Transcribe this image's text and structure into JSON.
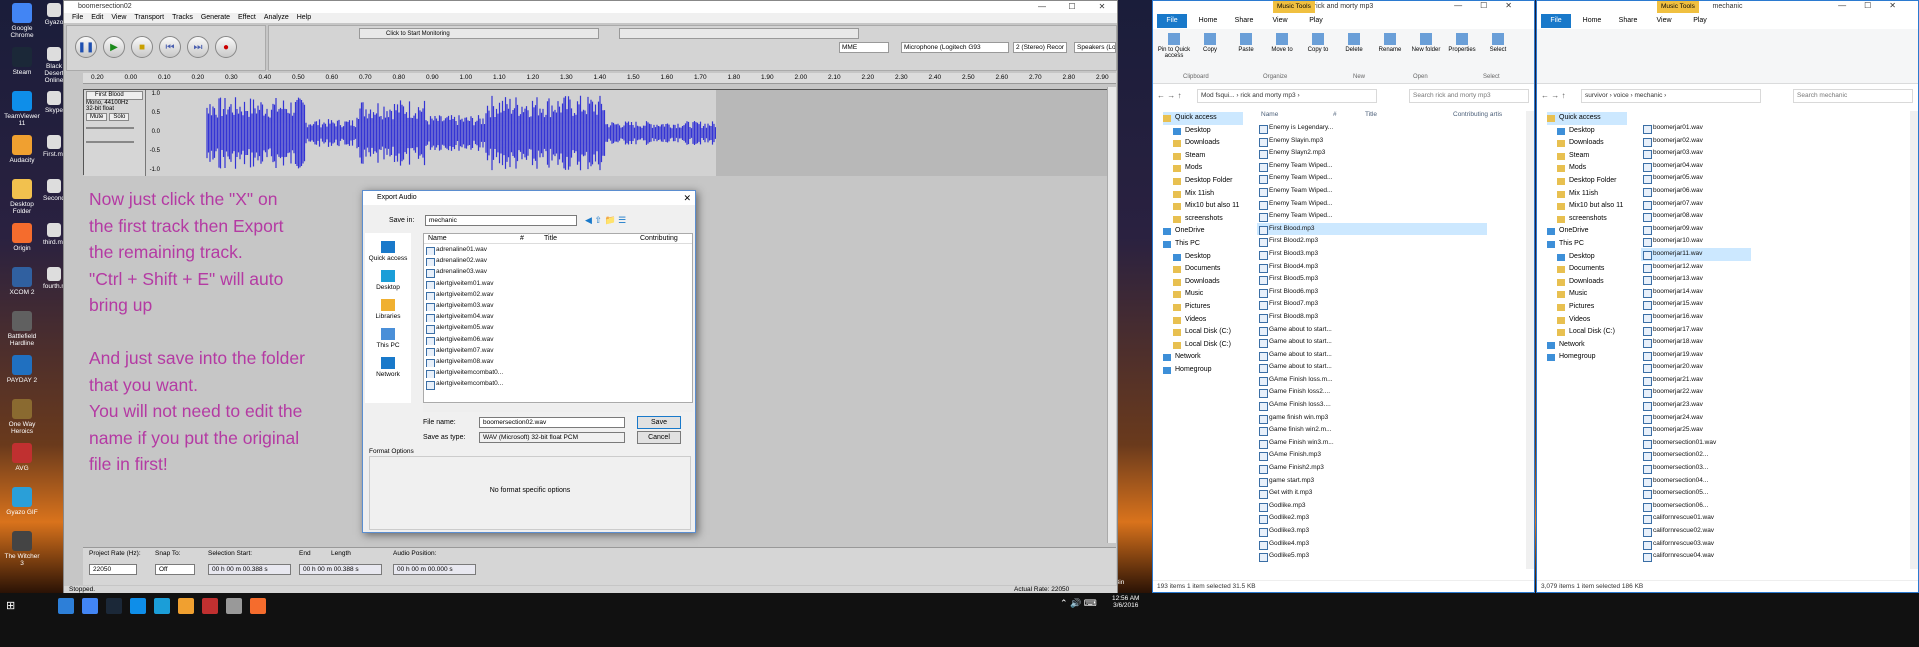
{
  "desktop": {
    "icons": [
      "Google Chrome",
      "Steam",
      "TeamViewer 11",
      "Audacity",
      "Desktop Folder",
      "Origin",
      "XCOM 2",
      "Battlefield Hardline",
      "PAYDAY 2",
      "One Way Heroics",
      "AVG",
      "Gyazo GIF",
      "The Witcher 3"
    ],
    "icons2": [
      "Gyazo",
      "Black Desert Online",
      "Skype",
      "First.mp3",
      "Second.mp3",
      "third.mp3",
      "fourth.mp3"
    ],
    "recycle": "Recycle Bin"
  },
  "audacity": {
    "title": "boomersection02",
    "menu": [
      "File",
      "Edit",
      "View",
      "Transport",
      "Tracks",
      "Generate",
      "Effect",
      "Analyze",
      "Help"
    ],
    "meter_text": "Click to Start Monitoring",
    "meter_ticks": [
      "-57",
      "-54",
      "-51",
      "-48",
      "-45",
      "-42",
      "-3",
      "-18",
      "-15",
      "-12",
      "-9",
      "-6",
      "-3",
      "0"
    ],
    "meter_ticks2": [
      "-57",
      "-54",
      "-51",
      "-48",
      "-45",
      "-42",
      "-39",
      "-36",
      "-30",
      "-27",
      "-24",
      "-21",
      "-18",
      "-15",
      "-12",
      "-9",
      "-6",
      "-3",
      "0"
    ],
    "host": "MME",
    "mic": "Microphone (Logitech G93",
    "channels": "2 (Stereo) Recor",
    "speakers": "Speakers (Logitech G930 Ga",
    "ruler": [
      "0.20",
      "0.00",
      "0.10",
      "0.20",
      "0.30",
      "0.40",
      "0.50",
      "0.60",
      "0.70",
      "0.80",
      "0.90",
      "1.00",
      "1.10",
      "1.20",
      "1.30",
      "1.40",
      "1.50",
      "1.60",
      "1.70",
      "1.80",
      "1.90",
      "2.00",
      "2.10",
      "2.20",
      "2.30",
      "2.40",
      "2.50",
      "2.60",
      "2.70",
      "2.80",
      "2.90"
    ],
    "track": {
      "name": "First Blood",
      "info1": "Mono, 44100Hz",
      "info2": "32-bit float",
      "mute": "Mute",
      "solo": "Solo",
      "scale": [
        "1.0",
        "0.5",
        "0.0",
        "-0.5",
        "-1.0"
      ]
    },
    "instructions": [
      "Now just click the \"X\" on",
      "the first track then Export",
      "the remaining track.",
      "\"Ctrl + Shift + E\" will auto",
      "bring up",
      "",
      "And just save into the folder",
      "that you want.",
      "You will not need to edit the",
      "name if you put the original",
      "file in first!"
    ],
    "bottom": {
      "rate_label": "Project Rate (Hz):",
      "rate": "22050",
      "snap_label": "Snap To:",
      "snap": "Off",
      "sel_label": "Selection Start:",
      "sel": "00 h 00 m 00.388 s",
      "end": "End",
      "length": "Length",
      "end_val": "00 h 00 m 00.388 s",
      "pos_label": "Audio Position:",
      "pos": "00 h 00 m 00.000 s"
    },
    "status": "Stopped.",
    "actual_rate": "Actual Rate: 22050"
  },
  "dialog": {
    "title": "Export Audio",
    "save_in_label": "Save in:",
    "save_in": "mechanic",
    "places": [
      "Quick access",
      "Desktop",
      "Libraries",
      "This PC",
      "Network"
    ],
    "cols": [
      "Name",
      "#",
      "Title",
      "Contributing"
    ],
    "files": [
      "adrenaline01.wav",
      "adrenaline02.wav",
      "adrenaline03.wav",
      "alertgiveitem01.wav",
      "alertgiveitem02.wav",
      "alertgiveitem03.wav",
      "alertgiveitem04.wav",
      "alertgiveitem05.wav",
      "alertgiveitem06.wav",
      "alertgiveitem07.wav",
      "alertgiveitem08.wav",
      "alertgiveitemcombat0...",
      "alertgiveitemcombat0..."
    ],
    "filename_label": "File name:",
    "filename": "boomersection02.wav",
    "type_label": "Save as type:",
    "type": "WAV (Microsoft) 32-bit float PCM",
    "save": "Save",
    "cancel": "Cancel",
    "options_label": "Format Options",
    "no_options": "No format specific options"
  },
  "exp1": {
    "title": "rick and morty mp3",
    "tools": "Music Tools",
    "tabs": [
      "File",
      "Home",
      "Share",
      "View",
      "Play"
    ],
    "groups": [
      "Clipboard",
      "Organize",
      "New",
      "Open",
      "Select"
    ],
    "rib": [
      "Pin to Quick access",
      "Copy",
      "Paste",
      "Move to",
      "Copy to",
      "Delete",
      "Rename",
      "New folder",
      "Properties",
      "Select"
    ],
    "path": [
      "Mod fsqui...",
      "rick and morty mp3"
    ],
    "search": "Search rick and morty mp3",
    "cols": [
      "Name",
      "#",
      "Title",
      "Contributing artis"
    ],
    "nav": [
      "Quick access",
      "Desktop",
      "Downloads",
      "Steam",
      "Mods",
      "Desktop Folder",
      "Mix 11ish",
      "Mix10 but also 11",
      "screenshots",
      "OneDrive",
      "This PC",
      "Desktop",
      "Documents",
      "Downloads",
      "Music",
      "Pictures",
      "Videos",
      "Local Disk (C:)",
      "Local Disk (C:)",
      "Network",
      "Homegroup"
    ],
    "files": [
      "Enemy is Legendary...",
      "Enemy Slayin.mp3",
      "Enemy Slayn2.mp3",
      "Enemy Team Wiped...",
      "Enemy Team Wiped...",
      "Enemy Team Wiped...",
      "Enemy Team Wiped...",
      "Enemy Team Wiped...",
      "First Blood.mp3",
      "First Blood2.mp3",
      "First Blood3.mp3",
      "First Blood4.mp3",
      "First Blood5.mp3",
      "First Blood6.mp3",
      "First Blood7.mp3",
      "First Blood8.mp3",
      "Game about to start...",
      "Game about to start...",
      "Game about to start...",
      "Game about to start...",
      "GAme Finish loss.m...",
      "Game Finish loss2....",
      "GAme Finish loss3....",
      "game finish win.mp3",
      "Game finish win2.m...",
      "Game Finish win3.m...",
      "GAme Finish.mp3",
      "Game Finish2.mp3",
      "game start.mp3",
      "Get with it.mp3",
      "Godlike.mp3",
      "Godlike2.mp3",
      "Godlike3.mp3",
      "Godlike4.mp3",
      "Godlike5.mp3"
    ],
    "status": "193 items     1 item selected  31.5 KB"
  },
  "exp2": {
    "title": "mechanic",
    "tools": "Music Tools",
    "tabs": [
      "File",
      "Home",
      "Share",
      "View",
      "Play"
    ],
    "path": [
      "survivor",
      "voice",
      "mechanic"
    ],
    "search": "Search mechanic",
    "nav": [
      "Quick access",
      "Desktop",
      "Downloads",
      "Steam",
      "Mods",
      "Desktop Folder",
      "Mix 11ish",
      "Mix10 but also 11",
      "screenshots",
      "OneDrive",
      "This PC",
      "Desktop",
      "Documents",
      "Downloads",
      "Music",
      "Pictures",
      "Videos",
      "Local Disk (C:)",
      "Network",
      "Homegroup"
    ],
    "files": [
      "boomerjar01.wav",
      "boomerjar02.wav",
      "boomerjar03.wav",
      "boomerjar04.wav",
      "boomerjar05.wav",
      "boomerjar06.wav",
      "boomerjar07.wav",
      "boomerjar08.wav",
      "boomerjar09.wav",
      "boomerjar10.wav",
      "boomerjar11.wav",
      "boomerjar12.wav",
      "boomerjar13.wav",
      "boomerjar14.wav",
      "boomerjar15.wav",
      "boomerjar16.wav",
      "boomerjar17.wav",
      "boomerjar18.wav",
      "boomerjar19.wav",
      "boomerjar20.wav",
      "boomerjar21.wav",
      "boomerjar22.wav",
      "boomerjar23.wav",
      "boomerjar24.wav",
      "boomerjar25.wav",
      "boomersection01.wav",
      "boomersection02...",
      "boomersection03...",
      "boomersection04...",
      "boomersection05...",
      "boomersection06...",
      "californrescue01.wav",
      "californrescue02.wav",
      "californrescue03.wav",
      "californrescue04.wav"
    ],
    "status": "3,079 items     1 item selected  186 KB"
  },
  "taskbar": {
    "time": "12:56 AM",
    "date": "3/6/2016"
  },
  "colors": {
    "accent": "#1979ca",
    "instr": "#b43aa3",
    "wave": "#3434d4"
  }
}
